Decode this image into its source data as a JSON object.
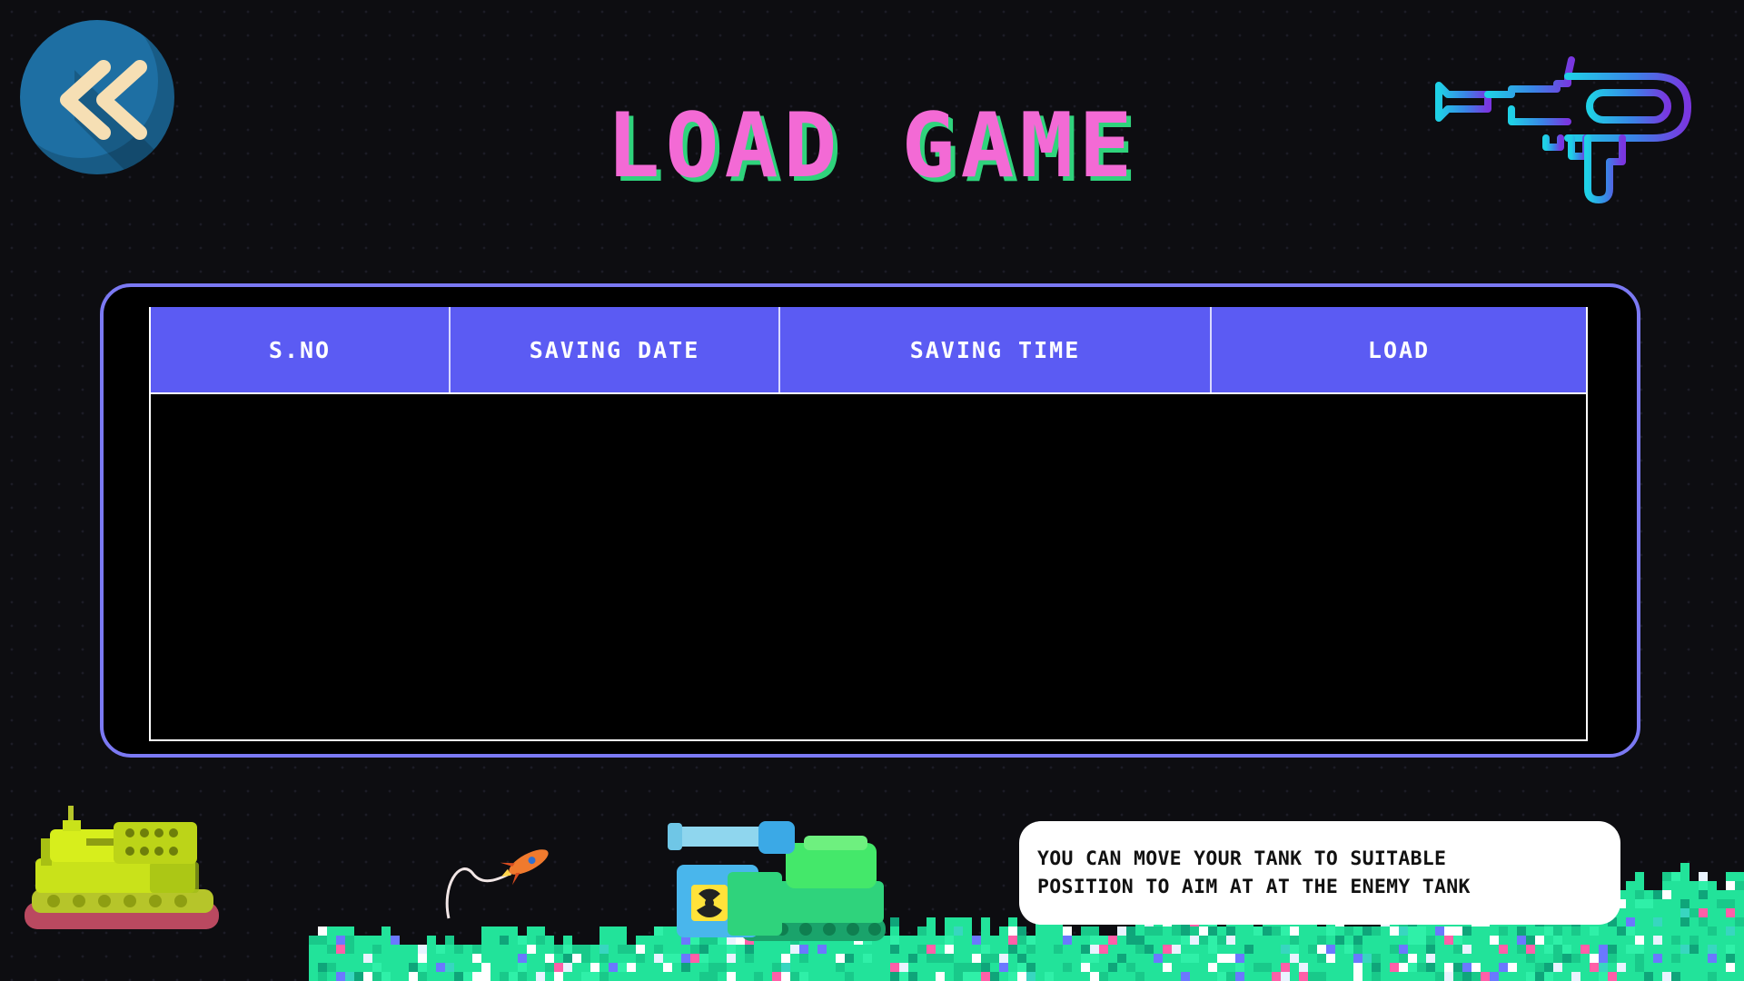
{
  "title": "LOAD GAME",
  "back_button": {
    "icon": "double-chevron-left-icon"
  },
  "decor": {
    "gun_icon": "blaster-icon"
  },
  "table": {
    "columns": [
      "S.NO",
      "SAVING DATE",
      "SAVING TIME",
      "LOAD"
    ],
    "rows": []
  },
  "tip": {
    "text": "YOU CAN MOVE YOUR TANK TO SUITABLE\nPOSITION TO AIM AT AT THE ENEMY TANK"
  },
  "colors": {
    "title": "#f36ad5",
    "title_shadow": "#2fd37c",
    "header_bg": "#5b5bf3",
    "panel_border": "#7b79f3",
    "back_button": "#1e6fa3"
  }
}
